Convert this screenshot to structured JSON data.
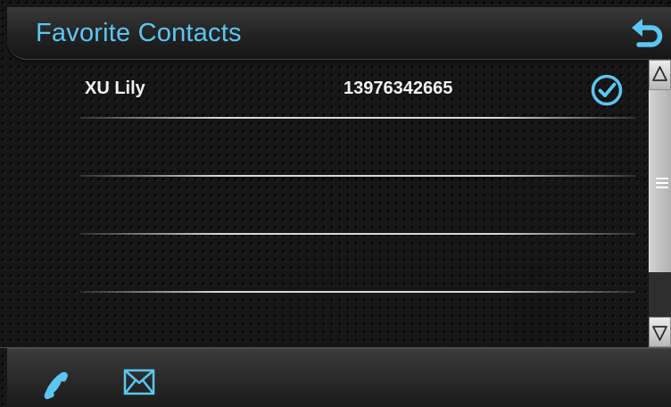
{
  "header": {
    "title": "Favorite Contacts",
    "back_icon": "back-arrow-icon"
  },
  "contacts": [
    {
      "name": "XU Lily",
      "phone": "13976342665",
      "selected": true,
      "check_icon": "checkmark-circle-icon"
    },
    {
      "name": "",
      "phone": "",
      "selected": false
    },
    {
      "name": "",
      "phone": "",
      "selected": false
    },
    {
      "name": "",
      "phone": "",
      "selected": false
    },
    {
      "name": "",
      "phone": "",
      "selected": false
    }
  ],
  "toolbar": {
    "call_icon": "phone-icon",
    "message_icon": "envelope-icon"
  },
  "scrollbar": {
    "up_icon": "arrow-up-icon",
    "down_icon": "arrow-down-icon",
    "grip_icon": "grip-lines-icon"
  },
  "colors": {
    "accent": "#5cc6f2",
    "text": "#f2f2f2",
    "background": "#161616"
  }
}
